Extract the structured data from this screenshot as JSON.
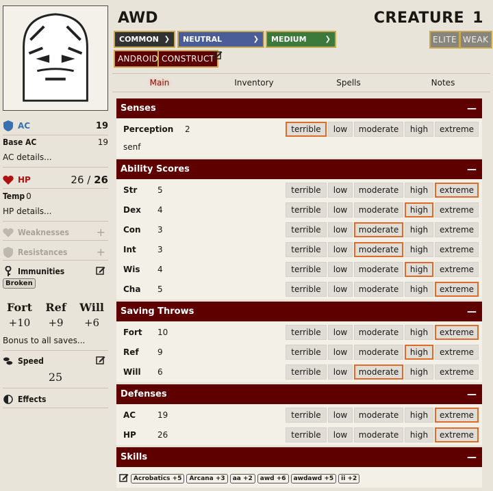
{
  "sidebar": {
    "ac": {
      "label": "AC",
      "value": "19"
    },
    "base_ac": {
      "label": "Base AC",
      "value": "19"
    },
    "ac_details": "AC details...",
    "hp": {
      "label": "HP",
      "value": "26",
      "slash": "/",
      "max": "26"
    },
    "temp": {
      "label": "Temp",
      "value": "0"
    },
    "hp_details": "HP details...",
    "weaknesses": "Weaknesses",
    "resistances": "Resistances",
    "immunities": "Immunities",
    "immunity_tags": [
      "Broken"
    ],
    "saves": [
      {
        "name": "Fort",
        "value": "+10"
      },
      {
        "name": "Ref",
        "value": "+9"
      },
      {
        "name": "Will",
        "value": "+6"
      }
    ],
    "save_bonus": "Bonus to all saves...",
    "speed": {
      "label": "Speed",
      "value": "25"
    },
    "effects": "Effects"
  },
  "header": {
    "name": "AWD",
    "type": "CREATURE",
    "level": "1",
    "rarity": "COMMON",
    "alignment": "NEUTRAL",
    "size": "MEDIUM",
    "traits": [
      "ANDROID",
      "CONSTRUCT"
    ],
    "elite": "ELITE",
    "weak": "WEAK"
  },
  "tabs": [
    "Main",
    "Inventory",
    "Spells",
    "Notes"
  ],
  "options": [
    "terrible",
    "low",
    "moderate",
    "high",
    "extreme"
  ],
  "sections": {
    "senses": {
      "title": "Senses",
      "perception": {
        "name": "Perception",
        "value": "2",
        "selected": "terrible"
      },
      "text": "senf"
    },
    "abilities": {
      "title": "Ability Scores",
      "rows": [
        {
          "name": "Str",
          "value": "5",
          "selected": "extreme"
        },
        {
          "name": "Dex",
          "value": "4",
          "selected": "high"
        },
        {
          "name": "Con",
          "value": "3",
          "selected": "moderate"
        },
        {
          "name": "Int",
          "value": "3",
          "selected": "moderate"
        },
        {
          "name": "Wis",
          "value": "4",
          "selected": "high"
        },
        {
          "name": "Cha",
          "value": "5",
          "selected": "extreme"
        }
      ]
    },
    "saves": {
      "title": "Saving Throws",
      "rows": [
        {
          "name": "Fort",
          "value": "10",
          "selected": "extreme"
        },
        {
          "name": "Ref",
          "value": "9",
          "selected": "high"
        },
        {
          "name": "Will",
          "value": "6",
          "selected": "moderate"
        }
      ]
    },
    "defenses": {
      "title": "Defenses",
      "rows": [
        {
          "name": "AC",
          "value": "19",
          "selected": "extreme"
        },
        {
          "name": "HP",
          "value": "26",
          "selected": "extreme"
        }
      ]
    },
    "skills": {
      "title": "Skills",
      "items": [
        "Acrobatics +5",
        "Arcana +3",
        "aa +2",
        "awd +6",
        "awdawd +5",
        "ii +2"
      ]
    }
  },
  "colors": {
    "section_header": "#5e0000",
    "selected_border": "#e06a2a",
    "common": "#323232",
    "neutral": "#4b5d98",
    "medium": "#3c7a3c"
  }
}
